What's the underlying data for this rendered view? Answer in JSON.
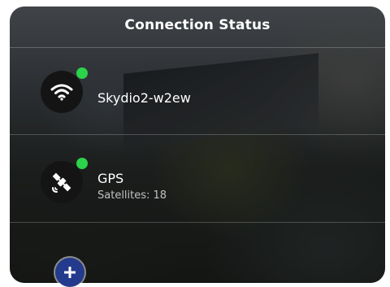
{
  "header": {
    "title": "Connection Status"
  },
  "connections": [
    {
      "name": "Skydio2-w2ew",
      "icon": "wifi-icon",
      "status": "connected",
      "status_color": "#2bd24a"
    },
    {
      "name": "GPS",
      "detail": "Satellites: 18",
      "icon": "satellite-icon",
      "status": "connected",
      "status_color": "#2bd24a"
    }
  ],
  "controls": {
    "add_icon": "plus-icon",
    "accent": "#243a8c"
  }
}
